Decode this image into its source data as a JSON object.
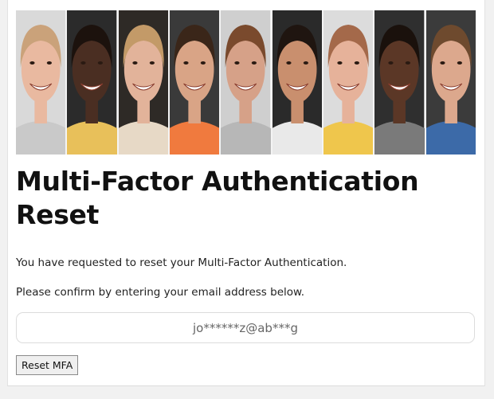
{
  "page": {
    "title": "Multi-Factor Authentication Reset",
    "intro": "You have requested to reset your Multi-Factor Authentication.",
    "instruction": "Please confirm by entering your email address below."
  },
  "email_field": {
    "value": "jo******z@ab***g"
  },
  "reset_button": {
    "label": "Reset MFA"
  },
  "banner": {
    "faces": [
      {
        "bg": "#d9d9d9",
        "skin": "#e9b9a0",
        "hair": "#caa27a",
        "shirt": "#c9c9c9"
      },
      {
        "bg": "#2b2b2b",
        "skin": "#4a2e22",
        "hair": "#1c120d",
        "shirt": "#e8c05a"
      },
      {
        "bg": "#2e2a26",
        "skin": "#e2b39a",
        "hair": "#c39a68",
        "shirt": "#e7d9c6"
      },
      {
        "bg": "#3a3a3a",
        "skin": "#d9a486",
        "hair": "#3a2619",
        "shirt": "#f07a3e"
      },
      {
        "bg": "#cfcfcf",
        "skin": "#d6a188",
        "hair": "#7a4a2d",
        "shirt": "#b7b7b7"
      },
      {
        "bg": "#2a2a2a",
        "skin": "#c98f6e",
        "hair": "#1f1510",
        "shirt": "#e9e9e9"
      },
      {
        "bg": "#dcdcdc",
        "skin": "#e6b29a",
        "hair": "#a4694a",
        "shirt": "#efc64c"
      },
      {
        "bg": "#2f2f2f",
        "skin": "#5b3726",
        "hair": "#1a110c",
        "shirt": "#7a7a7a"
      },
      {
        "bg": "#3b3b3b",
        "skin": "#dca88d",
        "hair": "#6e4a2e",
        "shirt": "#3c6aa8"
      }
    ]
  }
}
